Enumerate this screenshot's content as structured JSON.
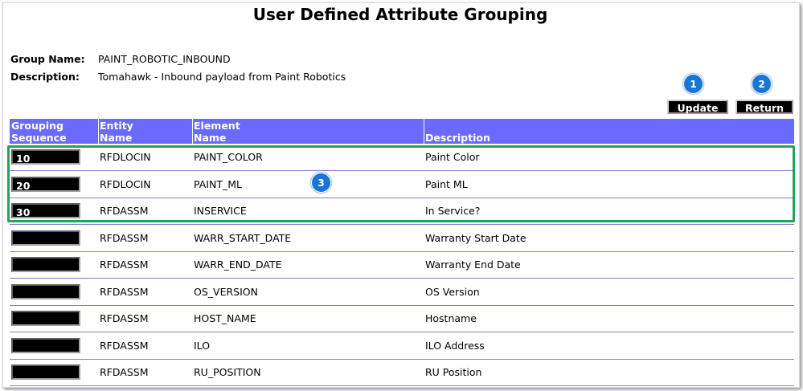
{
  "title": "User Defined Attribute Grouping",
  "group_name_label": "Group Name:",
  "group_name_value": "PAINT_ROBOTIC_INBOUND",
  "description_label": "Description:",
  "description_value": "Tomahawk - Inbound payload from Paint Robotics",
  "buttons": {
    "update": "Update",
    "return": "Return"
  },
  "callouts": [
    "1",
    "2",
    "3"
  ],
  "columns": [
    {
      "line1": "Grouping",
      "line2": "Sequence"
    },
    {
      "line1": "Entity",
      "line2": "Name"
    },
    {
      "line1": "Element",
      "line2": "Name"
    },
    {
      "line1": "",
      "line2": "Description"
    }
  ],
  "rows": [
    {
      "seq": "10",
      "entity": "RFDLOCIN",
      "element": "PAINT_COLOR",
      "description": "Paint Color"
    },
    {
      "seq": "20",
      "entity": "RFDLOCIN",
      "element": "PAINT_ML",
      "description": "Paint ML"
    },
    {
      "seq": "30",
      "entity": "RFDASSM",
      "element": "INSERVICE",
      "description": "In Service?"
    },
    {
      "seq": "",
      "entity": "RFDASSM",
      "element": "WARR_START_DATE",
      "description": "Warranty Start Date"
    },
    {
      "seq": "",
      "entity": "RFDASSM",
      "element": "WARR_END_DATE",
      "description": "Warranty End Date"
    },
    {
      "seq": "",
      "entity": "RFDASSM",
      "element": "OS_VERSION",
      "description": "OS Version"
    },
    {
      "seq": "",
      "entity": "RFDASSM",
      "element": "HOST_NAME",
      "description": "Hostname"
    },
    {
      "seq": "",
      "entity": "RFDASSM",
      "element": "ILO",
      "description": "ILO Address"
    },
    {
      "seq": "",
      "entity": "RFDASSM",
      "element": "RU_POSITION",
      "description": "RU Position"
    }
  ],
  "colors": {
    "header_bg": "#6a6aff",
    "highlight": "#21a45a",
    "callout": "#1877d6"
  }
}
